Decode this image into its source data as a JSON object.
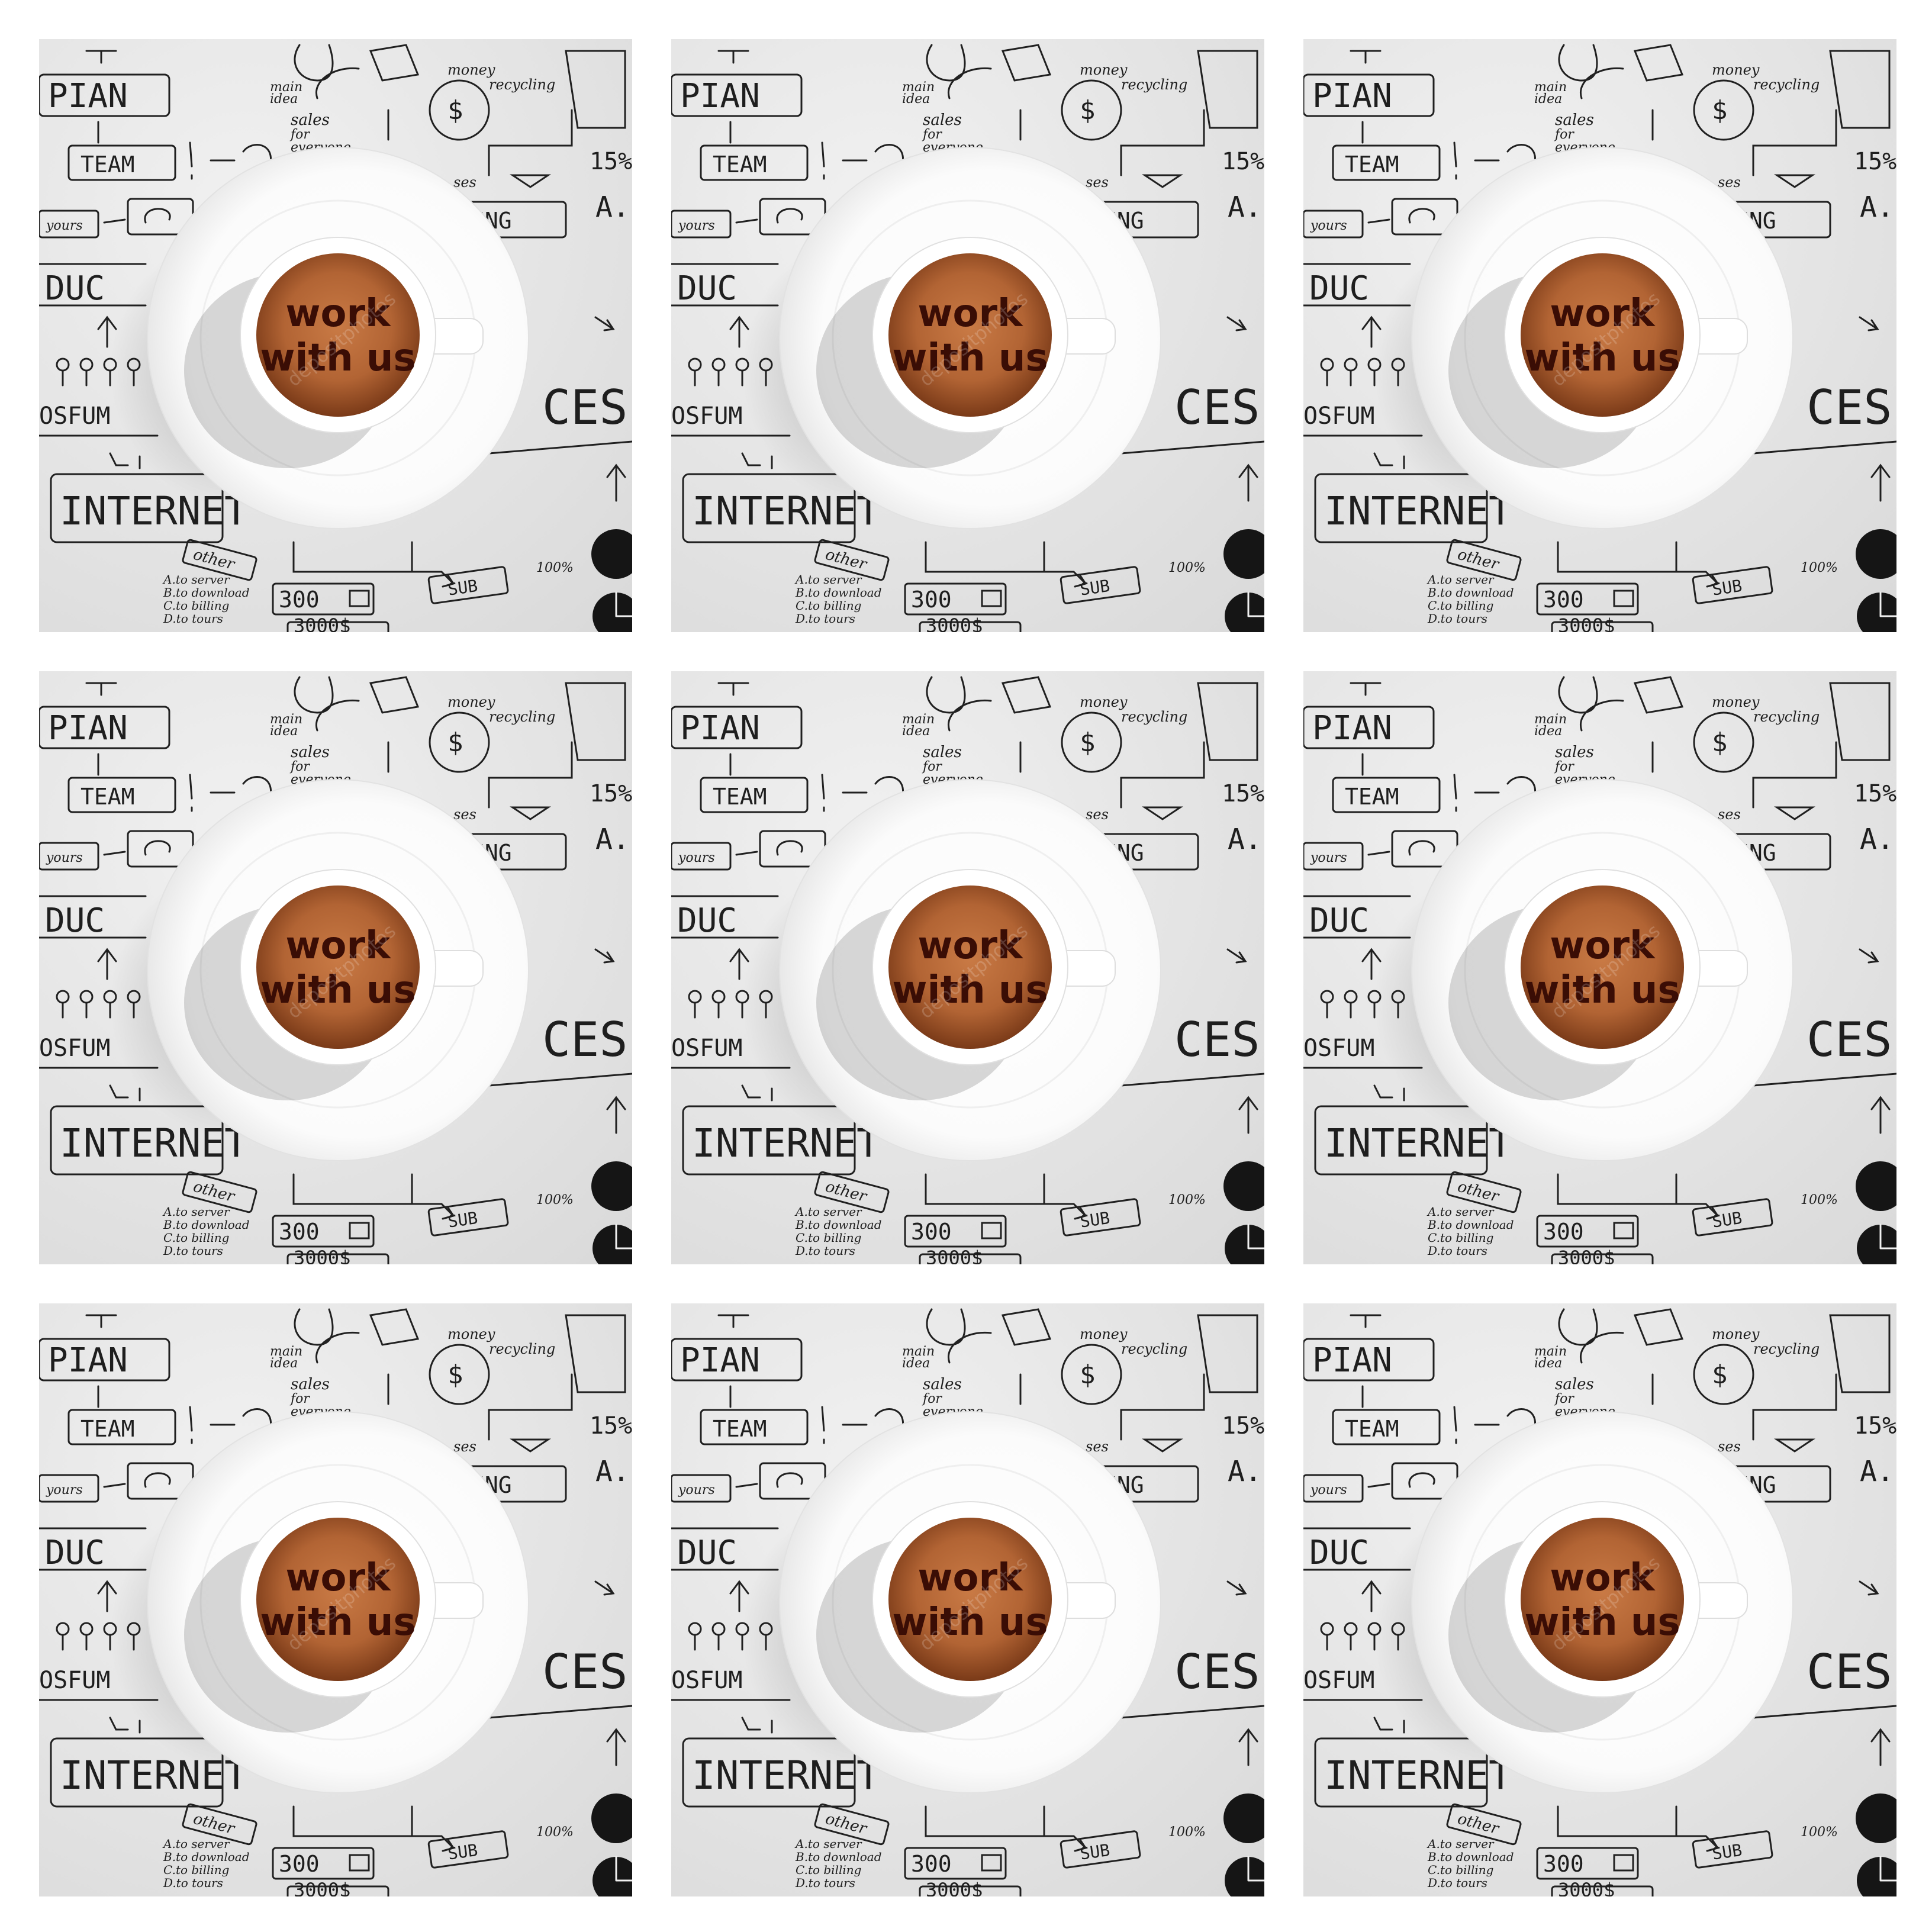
{
  "cup_text": {
    "line1": "work",
    "line2": "with us"
  },
  "watermark": "depositphotos",
  "sketch_labels": {
    "plan": "PIAN",
    "team": "TEAM",
    "yours": "yours",
    "ducs": "DUC",
    "osfum": "OSFUM",
    "internet": "INTERNET",
    "other": "other",
    "num300": "300",
    "sub": "SUB",
    "pct100": "100%",
    "pct15": "15%",
    "ing": "ING",
    "a": "A.",
    "ces": "CES",
    "money": "money",
    "recycling": "recycling",
    "dollar": "$",
    "main_idea_1": "main",
    "main_idea_2": "idea",
    "sales_1": "sales",
    "sales_2": "for",
    "sales_3": "everyone",
    "sales_word": "ses",
    "list_a": "A.to server",
    "list_b": "B.to download",
    "list_c": "C.to billing",
    "list_d": "D.to tours",
    "num3000": "3000$"
  },
  "colors": {
    "background": "#e6e6e6",
    "ink": "#1e1e1e",
    "coffee": "#b86a36",
    "cup_text": "#3a0d05",
    "saucer": "#ffffff"
  },
  "tiles": [
    {
      "row": 0,
      "col": 0
    },
    {
      "row": 0,
      "col": 1
    },
    {
      "row": 0,
      "col": 2
    },
    {
      "row": 1,
      "col": 0
    },
    {
      "row": 1,
      "col": 1
    },
    {
      "row": 1,
      "col": 2
    },
    {
      "row": 2,
      "col": 0
    },
    {
      "row": 2,
      "col": 1
    },
    {
      "row": 2,
      "col": 2
    }
  ]
}
